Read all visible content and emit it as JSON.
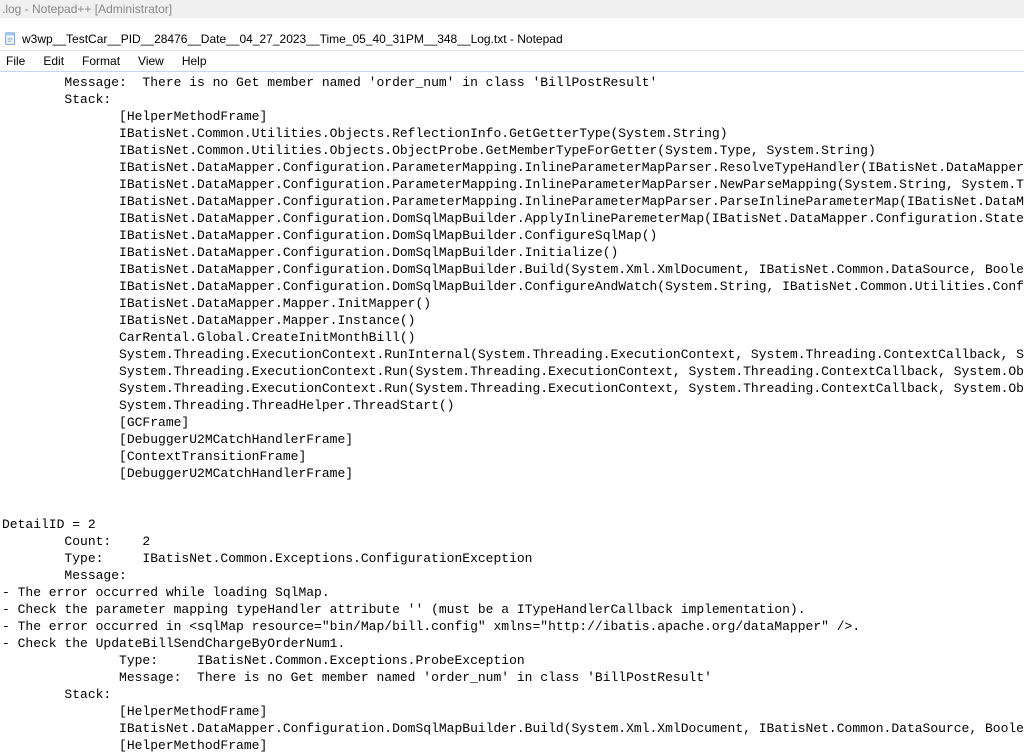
{
  "outer_window": {
    "title": ".log - Notepad++ [Administrator]"
  },
  "inner_window": {
    "icon": "notepad-icon",
    "title": "w3wp__TestCar__PID__28476__Date__04_27_2023__Time_05_40_31PM__348__Log.txt - Notepad"
  },
  "menu": {
    "file": "File",
    "edit": "Edit",
    "format": "Format",
    "view": "View",
    "help": "Help"
  },
  "log": {
    "lines": [
      "        Message:  There is no Get member named 'order_num' in class 'BillPostResult'",
      "        Stack:",
      "               [HelperMethodFrame]",
      "               IBatisNet.Common.Utilities.Objects.ReflectionInfo.GetGetterType(System.String)",
      "               IBatisNet.Common.Utilities.Objects.ObjectProbe.GetMemberTypeForGetter(System.Type, System.String)",
      "               IBatisNet.DataMapper.Configuration.ParameterMapping.InlineParameterMapParser.ResolveTypeHandler(IBatisNet.DataMapper.",
      "               IBatisNet.DataMapper.Configuration.ParameterMapping.InlineParameterMapParser.NewParseMapping(System.String, System.Typ",
      "               IBatisNet.DataMapper.Configuration.ParameterMapping.InlineParameterMapParser.ParseInlineParameterMap(IBatisNet.DataMap",
      "               IBatisNet.DataMapper.Configuration.DomSqlMapBuilder.ApplyInlineParemeterMap(IBatisNet.DataMapper.Configuration.Stateme",
      "               IBatisNet.DataMapper.Configuration.DomSqlMapBuilder.ConfigureSqlMap()",
      "               IBatisNet.DataMapper.Configuration.DomSqlMapBuilder.Initialize()",
      "               IBatisNet.DataMapper.Configuration.DomSqlMapBuilder.Build(System.Xml.XmlDocument, IBatisNet.Common.DataSource, Boolea",
      "               IBatisNet.DataMapper.Configuration.DomSqlMapBuilder.ConfigureAndWatch(System.String, IBatisNet.Common.Utilities.Confi",
      "               IBatisNet.DataMapper.Mapper.InitMapper()",
      "               IBatisNet.DataMapper.Mapper.Instance()",
      "               CarRental.Global.CreateInitMonthBill()",
      "               System.Threading.ExecutionContext.RunInternal(System.Threading.ExecutionContext, System.Threading.ContextCallback, Sy",
      "               System.Threading.ExecutionContext.Run(System.Threading.ExecutionContext, System.Threading.ContextCallback, System.Obj",
      "               System.Threading.ExecutionContext.Run(System.Threading.ExecutionContext, System.Threading.ContextCallback, System.Obj",
      "               System.Threading.ThreadHelper.ThreadStart()",
      "               [GCFrame]",
      "               [DebuggerU2MCatchHandlerFrame]",
      "               [ContextTransitionFrame]",
      "               [DebuggerU2MCatchHandlerFrame]",
      "",
      "",
      "DetailID = 2",
      "        Count:    2",
      "        Type:     IBatisNet.Common.Exceptions.ConfigurationException",
      "        Message:",
      "- The error occurred while loading SqlMap.",
      "- Check the parameter mapping typeHandler attribute '' (must be a ITypeHandlerCallback implementation).",
      "- The error occurred in <sqlMap resource=\"bin/Map/bill.config\" xmlns=\"http://ibatis.apache.org/dataMapper\" />.",
      "- Check the UpdateBillSendChargeByOrderNum1.",
      "               Type:     IBatisNet.Common.Exceptions.ProbeException",
      "               Message:  There is no Get member named 'order_num' in class 'BillPostResult'",
      "        Stack:",
      "               [HelperMethodFrame]",
      "               IBatisNet.DataMapper.Configuration.DomSqlMapBuilder.Build(System.Xml.XmlDocument, IBatisNet.Common.DataSource, Boolea",
      "               [HelperMethodFrame]"
    ]
  }
}
